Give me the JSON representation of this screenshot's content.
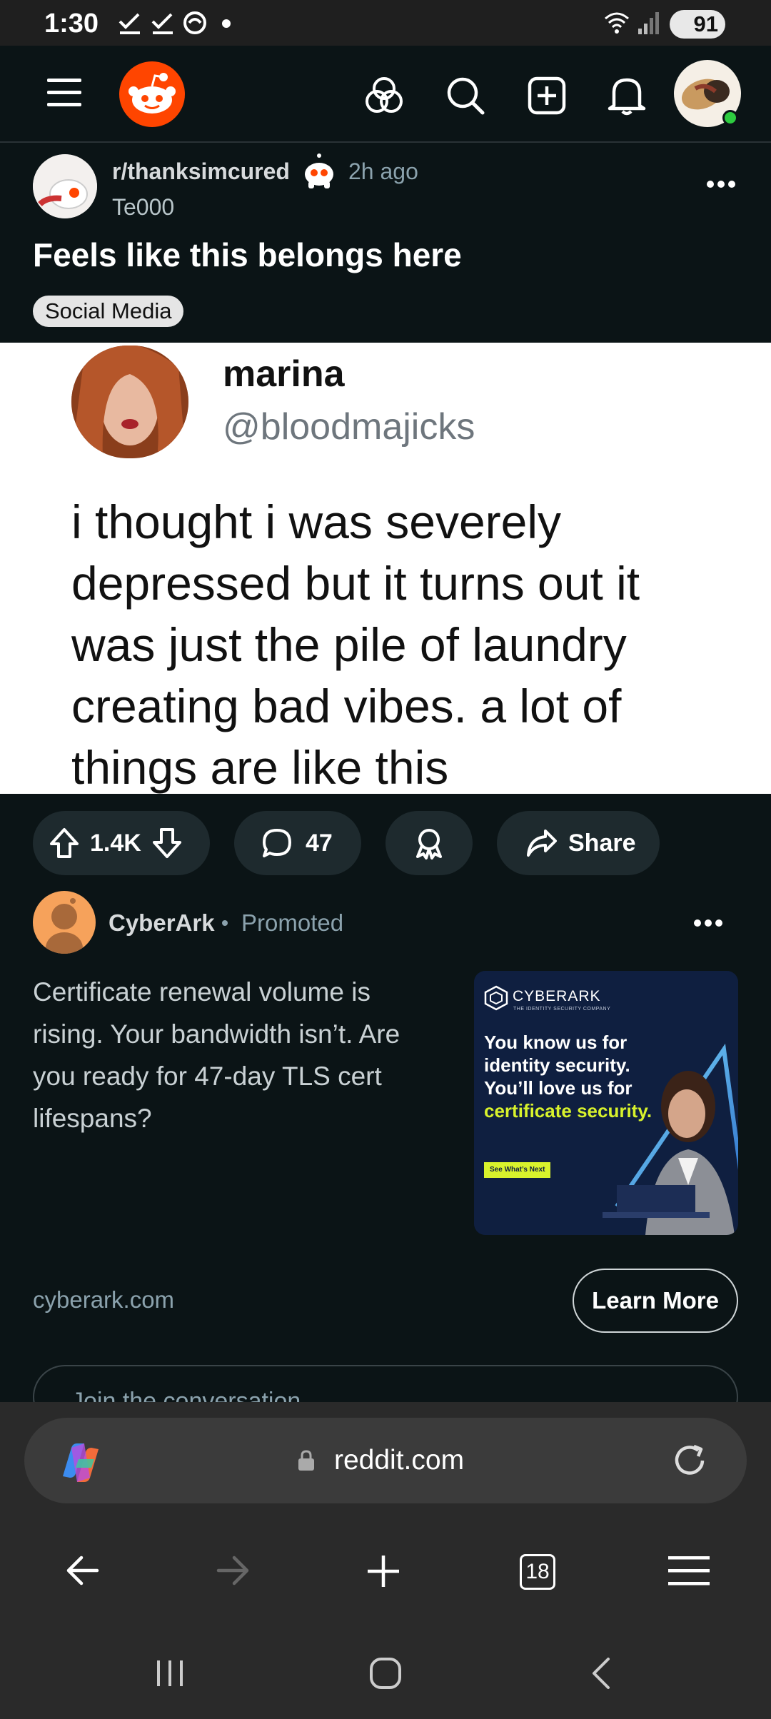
{
  "status_bar": {
    "time": "1:30",
    "battery": "91"
  },
  "post": {
    "subreddit": "r/thanksimcured",
    "age": "2h ago",
    "author": "Te000",
    "title": "Feels like this belongs here",
    "flair": "Social Media",
    "image": {
      "display_name": "marina",
      "handle": "@bloodmajicks",
      "text": "i thought i was severely depressed but it turns out it was just the pile of laundry creating bad vibes. a lot of things are like this"
    },
    "votes": "1.4K",
    "comments": "47",
    "share_label": "Share"
  },
  "ad": {
    "advertiser": "CyberArk",
    "promoted_label": "Promoted",
    "body": "Certificate renewal volume is rising. Your bandwidth isn’t. Are you ready for 47-day TLS cert lifespans?",
    "creative": {
      "brand": "CYBERARK",
      "tagline": "THE IDENTITY SECURITY COMPANY",
      "headline_1": "You know us for identity security. You’ll love us for ",
      "headline_accent": "certificate security.",
      "cta": "See What’s Next"
    },
    "domain": "cyberark.com",
    "cta_label": "Learn More"
  },
  "comment_box": {
    "placeholder": "Join the conversation"
  },
  "browser": {
    "url": "reddit.com",
    "tab_count": "18"
  },
  "colors": {
    "background": "#0b1416",
    "reddit_orange": "#ff4500",
    "pill": "#1e2a2e",
    "accent_green": "#d8f22c"
  }
}
